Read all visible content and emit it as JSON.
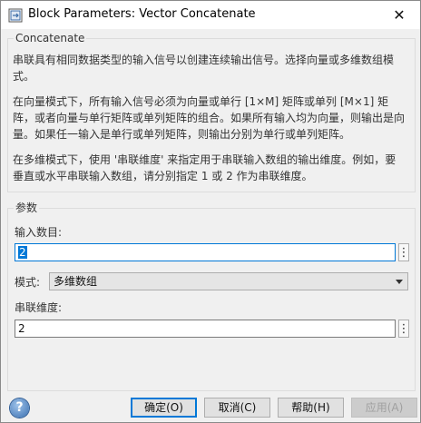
{
  "window": {
    "title": "Block Parameters: Vector Concatenate",
    "close_glyph": "✕",
    "app_icon": "simulink-block-icon"
  },
  "description": {
    "legend": "Concatenate",
    "paragraphs": [
      "串联具有相同数据类型的输入信号以创建连续输出信号。选择向量或多维数组模式。",
      "在向量模式下，所有输入信号必须为向量或单行 [1×M] 矩阵或单列 [M×1] 矩阵，或者向量与单行矩阵或单列矩阵的组合。如果所有输入均为向量，则输出是向量。如果任一输入是单行或单列矩阵，则输出分别为单行或单列矩阵。",
      "在多维模式下，使用 '串联维度' 来指定用于串联输入数组的输出维度。例如，要垂直或水平串联输入数组，请分别指定 1 或 2 作为串联维度。"
    ]
  },
  "params": {
    "legend": "参数",
    "num_inputs_label": "输入数目:",
    "num_inputs_value": "2",
    "mode_label": "模式:",
    "mode_value": "多维数组",
    "concat_dim_label": "串联维度:",
    "concat_dim_value": "2",
    "more_glyph": "⋮"
  },
  "buttons": {
    "ok": "确定(O)",
    "cancel": "取消(C)",
    "help": "帮助(H)",
    "apply": "应用(A)",
    "help_icon_glyph": "?"
  }
}
